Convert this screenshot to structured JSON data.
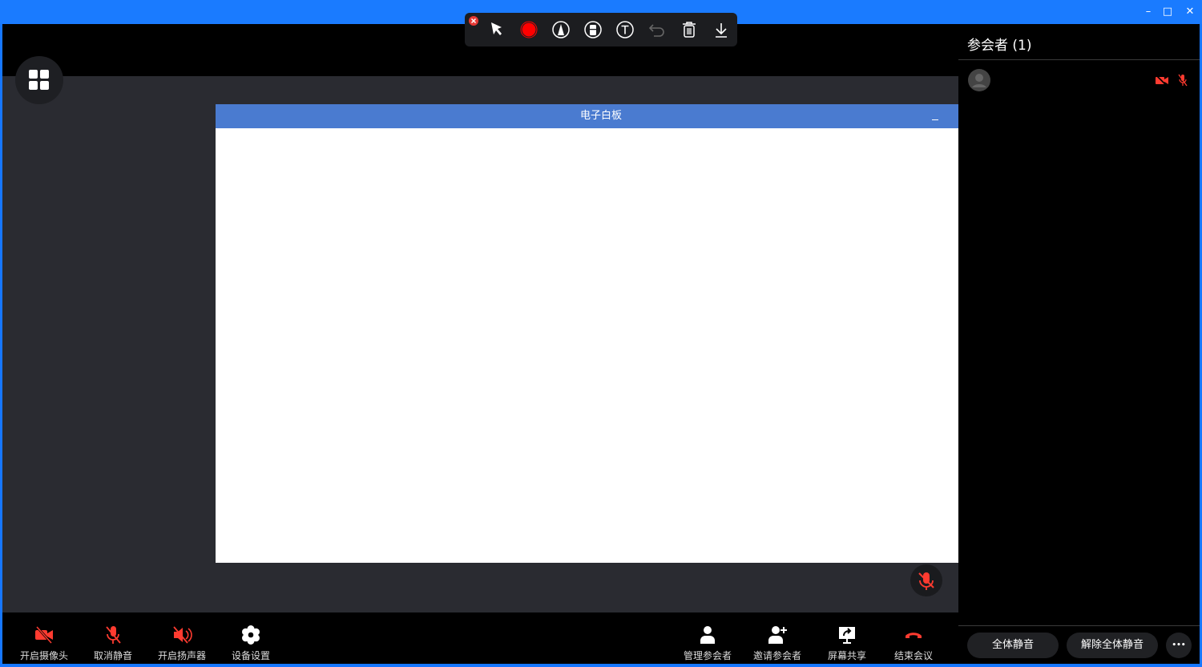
{
  "colors": {
    "accent": "#1a7bff",
    "danger": "#ff3b30",
    "whiteboard_title": "#4a7bd0"
  },
  "whiteboard": {
    "title": "电子白板"
  },
  "panel": {
    "title": "参会者 (1)",
    "mute_all": "全体静音",
    "unmute_all": "解除全体静音",
    "more": "•••"
  },
  "bottom_left": [
    {
      "icon": "camera-off-icon",
      "label": "开启摄像头"
    },
    {
      "icon": "mic-off-icon",
      "label": "取消静音"
    },
    {
      "icon": "speaker-off-icon",
      "label": "开启扬声器"
    },
    {
      "icon": "gear-icon",
      "label": "设备设置"
    }
  ],
  "bottom_right": [
    {
      "icon": "user-icon",
      "label": "管理参会者"
    },
    {
      "icon": "user-plus-icon",
      "label": "邀请参会者"
    },
    {
      "icon": "screen-share-icon",
      "label": "屏幕共享"
    },
    {
      "icon": "hang-up-icon",
      "label": "结束会议"
    }
  ],
  "window": {
    "minimize": "–",
    "maximize": "□",
    "close": "✕"
  }
}
